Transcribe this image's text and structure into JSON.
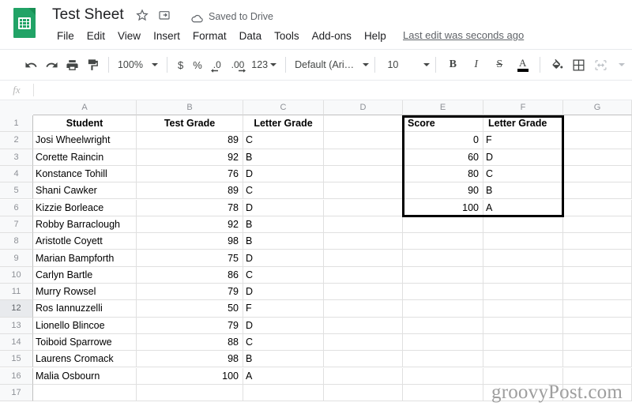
{
  "header": {
    "logo_icon": "google-sheets-logo",
    "doc_title": "Test Sheet",
    "star_icon": "star-icon",
    "move_icon": "move-to-folder-icon",
    "cloud_icon": "cloud-icon",
    "saved_status": "Saved to Drive",
    "menus": [
      "File",
      "Edit",
      "View",
      "Insert",
      "Format",
      "Data",
      "Tools",
      "Add-ons",
      "Help"
    ],
    "last_edit": "Last edit was seconds ago"
  },
  "toolbar": {
    "undo_icon": "undo-icon",
    "redo_icon": "redo-icon",
    "print_icon": "print-icon",
    "paint_format_icon": "paint-format-icon",
    "zoom_level": "100%",
    "currency_label": "$",
    "percent_label": "%",
    "decrease_decimal_label": ".0",
    "increase_decimal_label": ".00",
    "more_formats_label": "123",
    "font_family": "Default (Ari…",
    "font_size": "10",
    "bold_label": "B",
    "italic_label": "I",
    "strikethrough_label": "S",
    "text_color_label": "A",
    "fill_color_icon": "fill-color-icon",
    "borders_icon": "borders-icon",
    "merge_cells_icon": "merge-cells-icon"
  },
  "formula_bar": {
    "fx_label": "fx",
    "value": ""
  },
  "grid": {
    "columns": [
      "A",
      "B",
      "C",
      "D",
      "E",
      "F",
      "G"
    ],
    "rows": [
      "1",
      "2",
      "3",
      "4",
      "5",
      "6",
      "7",
      "8",
      "9",
      "10",
      "11",
      "12",
      "13",
      "14",
      "15",
      "16",
      "17"
    ],
    "active_row": "12",
    "headers": {
      "student": "Student",
      "test_grade": "Test Grade",
      "letter_grade": "Letter Grade"
    },
    "students": [
      {
        "row": "2",
        "name": "Josi Wheelwright",
        "score": "89",
        "grade": "C"
      },
      {
        "row": "3",
        "name": "Corette Raincin",
        "score": "92",
        "grade": "B"
      },
      {
        "row": "4",
        "name": "Konstance Tohill",
        "score": "76",
        "grade": "D"
      },
      {
        "row": "5",
        "name": "Shani Cawker",
        "score": "89",
        "grade": "C"
      },
      {
        "row": "6",
        "name": "Kizzie Borleace",
        "score": "78",
        "grade": "D"
      },
      {
        "row": "7",
        "name": "Robby Barraclough",
        "score": "92",
        "grade": "B"
      },
      {
        "row": "8",
        "name": "Aristotle Coyett",
        "score": "98",
        "grade": "B"
      },
      {
        "row": "9",
        "name": "Marian Bampforth",
        "score": "75",
        "grade": "D"
      },
      {
        "row": "10",
        "name": "Carlyn Bartle",
        "score": "86",
        "grade": "C"
      },
      {
        "row": "11",
        "name": "Murry Rowsel",
        "score": "79",
        "grade": "D"
      },
      {
        "row": "12",
        "name": "Ros Iannuzzelli",
        "score": "50",
        "grade": "F"
      },
      {
        "row": "13",
        "name": "Lionello Blincoe",
        "score": "79",
        "grade": "D"
      },
      {
        "row": "14",
        "name": "Toiboid Sparrowe",
        "score": "88",
        "grade": "C"
      },
      {
        "row": "15",
        "name": "Laurens Cromack",
        "score": "98",
        "grade": "B"
      },
      {
        "row": "16",
        "name": "Malia Osbourn",
        "score": "100",
        "grade": "A"
      }
    ],
    "lookup_table": {
      "header_score": "Score",
      "header_letter": "Letter Grade",
      "rows": [
        {
          "row": "2",
          "score": "0",
          "letter": "F"
        },
        {
          "row": "3",
          "score": "60",
          "letter": "D"
        },
        {
          "row": "4",
          "score": "80",
          "letter": "C"
        },
        {
          "row": "5",
          "score": "90",
          "letter": "B"
        },
        {
          "row": "6",
          "score": "100",
          "letter": "A"
        }
      ]
    }
  },
  "watermark": "groovyPost.com",
  "colors": {
    "sheets_green": "#21a366",
    "header_bg": "#f8f9fa",
    "gridline": "#e0e0e0",
    "text": "#202124"
  }
}
